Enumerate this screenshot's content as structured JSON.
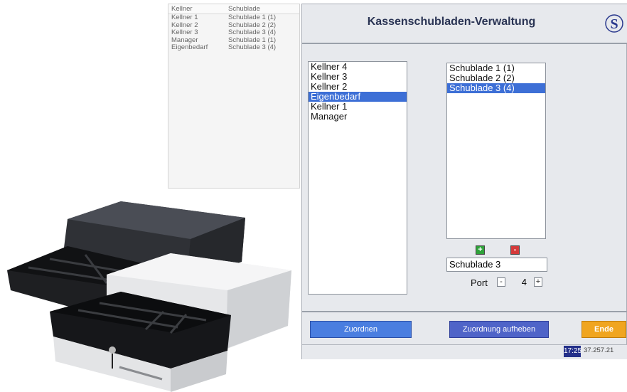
{
  "overview": {
    "headers": [
      "Kellner",
      "Schublade"
    ],
    "rows": [
      [
        "Kellner 1",
        "Schublade 1 (1)"
      ],
      [
        "Kellner 2",
        "Schublade 2 (2)"
      ],
      [
        "Kellner 3",
        "Schublade 3 (4)"
      ],
      [
        "Manager",
        "Schublade 1 (1)"
      ],
      [
        "Eigenbedarf",
        "Schublade 3 (4)"
      ]
    ]
  },
  "window": {
    "title": "Kassenschubladen-Verwaltung",
    "waiters": [
      "Kellner 4",
      "Kellner 3",
      "Kellner 2",
      "Eigenbedarf",
      "Kellner 1",
      "Manager"
    ],
    "waiters_selected": "Eigenbedarf",
    "drawers": [
      "Schublade 1 (1)",
      "Schublade 2 (2)",
      "Schublade 3 (4)"
    ],
    "drawers_selected": "Schublade 3 (4)",
    "add_symbol": "+",
    "remove_symbol": "-",
    "drawer_name": "Schublade 3",
    "port_label": "Port",
    "port_dec": "-",
    "port_value": "4",
    "port_inc": "+",
    "assign_label": "Zuordnen",
    "unassign_label": "Zuordnung aufheben",
    "exit_label": "Ende",
    "time": "17:25",
    "date": "37.257.21"
  },
  "colors": {
    "selection": "#3d6fd6",
    "assign_button": "#4a7ee0",
    "unassign_button": "#4f64c8",
    "exit_button": "#f0a520",
    "add_button": "#2fa23a",
    "remove_button": "#d53a3a",
    "clock_bg": "#24308a"
  }
}
